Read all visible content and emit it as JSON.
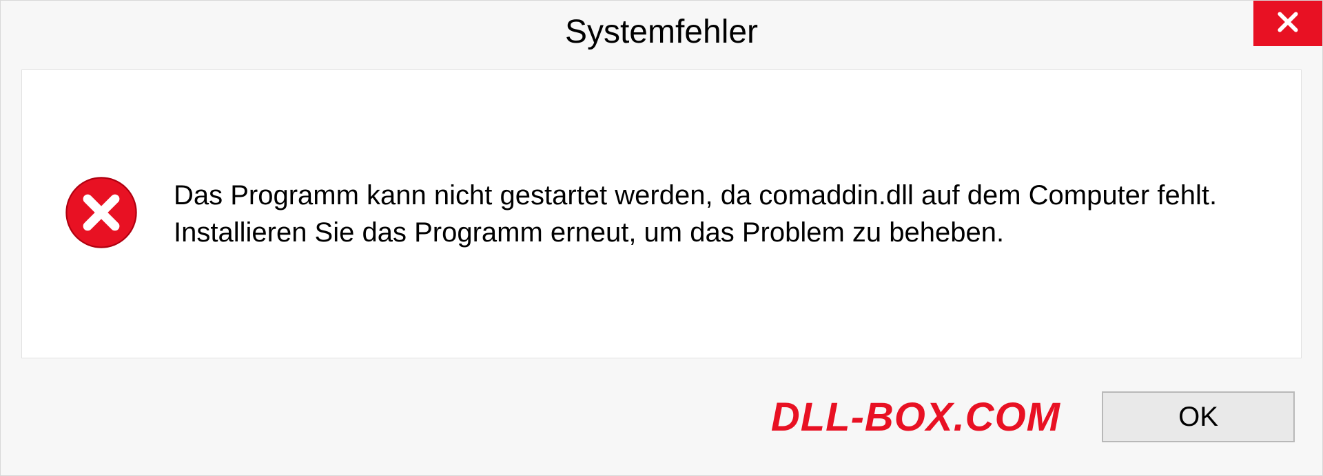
{
  "dialog": {
    "title": "Systemfehler",
    "message": "Das Programm kann nicht gestartet werden, da comaddin.dll auf dem Computer fehlt. Installieren Sie das Programm erneut, um das Problem zu beheben.",
    "ok_label": "OK"
  },
  "watermark": "DLL-BOX.COM",
  "colors": {
    "close_bg": "#e81123",
    "watermark": "#e81123"
  }
}
